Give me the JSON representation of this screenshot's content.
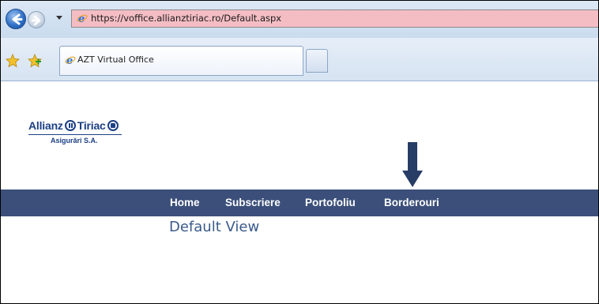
{
  "browser": {
    "address_url": "https://voffice.allianztiriac.ro/Default.aspx",
    "tab_title": "AZT Virtual Office"
  },
  "logo": {
    "brand_left": "Allianz",
    "brand_right": "Tiriac",
    "subtitle": "Asigurări S.A."
  },
  "menu": {
    "items": [
      {
        "label": "Home"
      },
      {
        "label": "Subscriere"
      },
      {
        "label": "Portofoliu"
      },
      {
        "label": "Borderouri"
      }
    ]
  },
  "main": {
    "heading": "Default View"
  },
  "colors": {
    "menu_bar": "#3b4f7a",
    "arrow": "#283d66",
    "brand": "#1c3f85",
    "address_bar": "#f4bdc4"
  }
}
